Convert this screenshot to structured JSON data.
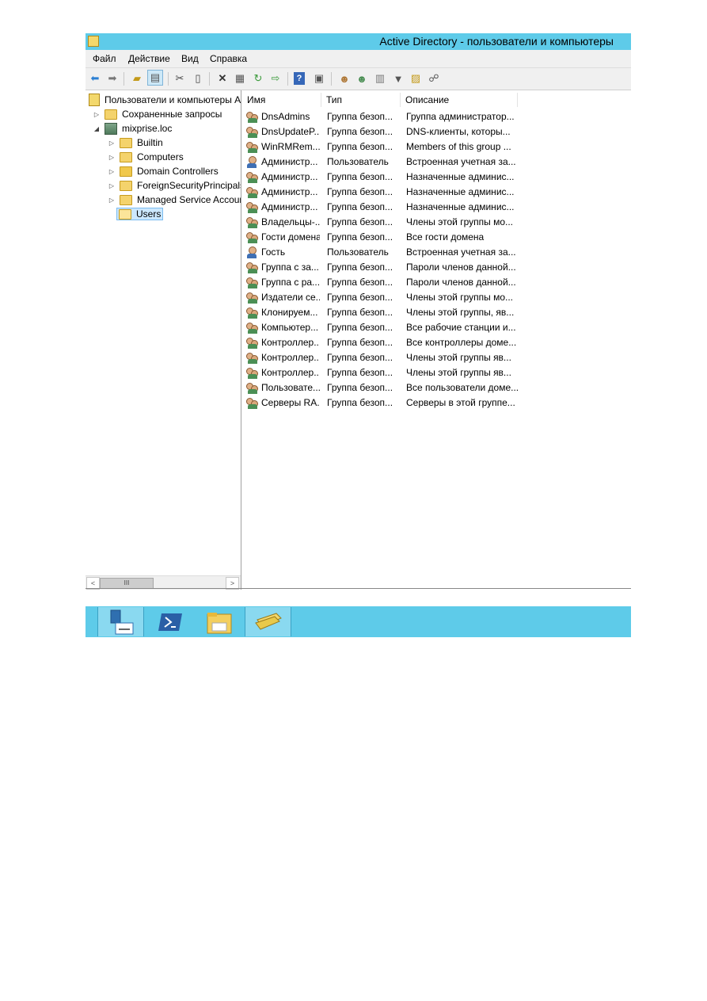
{
  "window": {
    "title": "Active Directory - пользователи и компьютеры"
  },
  "menu": [
    "Файл",
    "Действие",
    "Вид",
    "Справка"
  ],
  "toolbar": [
    "back-icon",
    "forward-icon",
    "up-folder-icon",
    "show-hide-tree-icon",
    "cut-icon",
    "paste-icon",
    "delete-icon",
    "properties-icon",
    "refresh-icon",
    "export-icon",
    "help-icon",
    "console-icon",
    "new-user-icon",
    "new-group-icon",
    "new-ou-icon",
    "filter-icon",
    "find-icon",
    "add-to-group-icon"
  ],
  "tree": {
    "root": "Пользователи и компьютеры Active Directory",
    "saved_queries": "Сохраненные запросы",
    "domain": "mixprise.loc",
    "children": [
      "Builtin",
      "Computers",
      "Domain Controllers",
      "ForeignSecurityPrincipals",
      "Managed Service Accounts",
      "Users"
    ]
  },
  "scrollbar": {
    "left": "<",
    "thumb": "III",
    "right": ">"
  },
  "list": {
    "columns": [
      "Имя",
      "Тип",
      "Описание"
    ],
    "rows": [
      {
        "name": "DnsAdmins",
        "type": "Группа безоп...",
        "desc": "Группа администратор...",
        "kind": "group"
      },
      {
        "name": "DnsUpdateP...",
        "type": "Группа безоп...",
        "desc": "DNS-клиенты, которы...",
        "kind": "group"
      },
      {
        "name": "WinRMRem...",
        "type": "Группа безоп...",
        "desc": "Members of this group ...",
        "kind": "group"
      },
      {
        "name": "Администр...",
        "type": "Пользователь",
        "desc": "Встроенная учетная за...",
        "kind": "user"
      },
      {
        "name": "Администр...",
        "type": "Группа безоп...",
        "desc": "Назначенные админис...",
        "kind": "group"
      },
      {
        "name": "Администр...",
        "type": "Группа безоп...",
        "desc": "Назначенные админис...",
        "kind": "group"
      },
      {
        "name": "Администр...",
        "type": "Группа безоп...",
        "desc": "Назначенные админис...",
        "kind": "group"
      },
      {
        "name": "Владельцы-...",
        "type": "Группа безоп...",
        "desc": "Члены этой группы мо...",
        "kind": "group"
      },
      {
        "name": "Гости домена",
        "type": "Группа безоп...",
        "desc": "Все гости домена",
        "kind": "group"
      },
      {
        "name": "Гость",
        "type": "Пользователь",
        "desc": "Встроенная учетная за...",
        "kind": "user"
      },
      {
        "name": "Группа с за...",
        "type": "Группа безоп...",
        "desc": "Пароли членов данной...",
        "kind": "group"
      },
      {
        "name": "Группа с ра...",
        "type": "Группа безоп...",
        "desc": "Пароли членов данной...",
        "kind": "group"
      },
      {
        "name": "Издатели се...",
        "type": "Группа безоп...",
        "desc": "Члены этой группы мо...",
        "kind": "group"
      },
      {
        "name": "Клонируем...",
        "type": "Группа безоп...",
        "desc": "Члены этой группы, яв...",
        "kind": "group"
      },
      {
        "name": "Компьютер...",
        "type": "Группа безоп...",
        "desc": "Все рабочие станции и...",
        "kind": "group"
      },
      {
        "name": "Контроллер...",
        "type": "Группа безоп...",
        "desc": "Все контроллеры доме...",
        "kind": "group"
      },
      {
        "name": "Контроллер...",
        "type": "Группа безоп...",
        "desc": "Члены этой группы яв...",
        "kind": "group"
      },
      {
        "name": "Контроллер...",
        "type": "Группа безоп...",
        "desc": "Члены этой группы яв...",
        "kind": "group"
      },
      {
        "name": "Пользовате...",
        "type": "Группа безоп...",
        "desc": "Все пользователи доме...",
        "kind": "group"
      },
      {
        "name": "Серверы RA...",
        "type": "Группа безоп...",
        "desc": "Серверы в этой группе...",
        "kind": "group"
      }
    ]
  },
  "taskbar": [
    "server-manager-icon",
    "powershell-icon",
    "file-explorer-icon",
    "ad-users-computers-icon"
  ]
}
